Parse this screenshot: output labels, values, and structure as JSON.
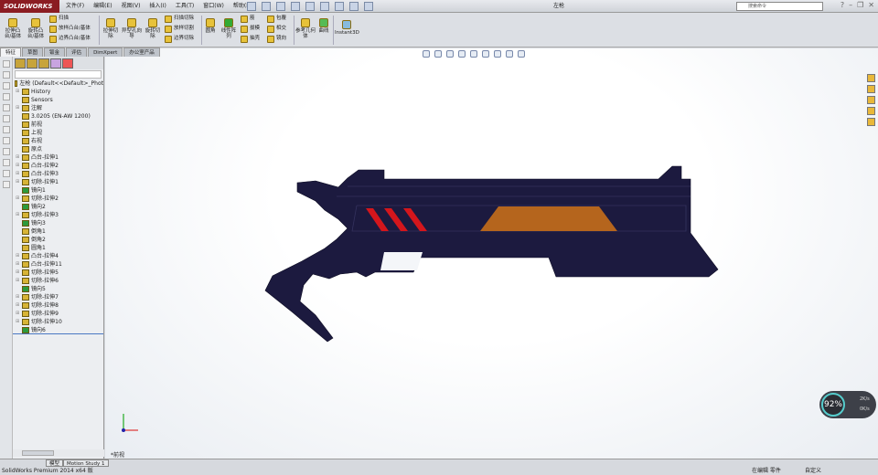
{
  "app": {
    "logo": "SOLIDWORKS",
    "title": "左枪",
    "search_placeholder": "搜索命令"
  },
  "menu": [
    "文件(F)",
    "编辑(E)",
    "视图(V)",
    "插入(I)",
    "工具(T)",
    "窗口(W)",
    "帮助(H)"
  ],
  "ribbon": {
    "large": [
      "拉伸凸台/基体",
      "旋转凸台/基体",
      "拉伸切除",
      "异型孔向导",
      "旋转切除",
      "圆角",
      "线性阵列",
      "参考几何体",
      "曲线",
      "Instant3D"
    ],
    "small": [
      "扫描",
      "放样凸台/基体",
      "边界凸台/基体",
      "扫描切除",
      "放样切割",
      "边界切除",
      "筋",
      "拔模",
      "抽壳",
      "包覆",
      "相交",
      "镜向"
    ]
  },
  "tabs": [
    "特征",
    "草图",
    "钣金",
    "评估",
    "DimXpert",
    "办公室产品"
  ],
  "tree": {
    "root": "左枪 (Default<<Default>_Phot",
    "nodes": [
      {
        "label": "History",
        "exp": true
      },
      {
        "label": "Sensors",
        "exp": false
      },
      {
        "label": "注解",
        "exp": true
      },
      {
        "label": "3.0205 (EN-AW 1200)",
        "exp": false
      },
      {
        "label": "前视",
        "exp": false
      },
      {
        "label": "上视",
        "exp": false
      },
      {
        "label": "右视",
        "exp": false
      },
      {
        "label": "原点",
        "exp": false
      },
      {
        "label": "凸台-拉伸1",
        "exp": true
      },
      {
        "label": "凸台-拉伸2",
        "exp": true
      },
      {
        "label": "凸台-拉伸3",
        "exp": true
      },
      {
        "label": "切除-拉伸1",
        "exp": true
      },
      {
        "label": "镜向1",
        "exp": false,
        "m": true
      },
      {
        "label": "切除-拉伸2",
        "exp": true
      },
      {
        "label": "镜向2",
        "exp": false,
        "m": true
      },
      {
        "label": "切除-拉伸3",
        "exp": true
      },
      {
        "label": "镜向3",
        "exp": false,
        "m": true
      },
      {
        "label": "倒角1",
        "exp": false
      },
      {
        "label": "倒角2",
        "exp": false
      },
      {
        "label": "圆角1",
        "exp": false
      },
      {
        "label": "凸台-拉伸4",
        "exp": true
      },
      {
        "label": "凸台-拉伸11",
        "exp": true
      },
      {
        "label": "切除-拉伸5",
        "exp": true
      },
      {
        "label": "切除-拉伸6",
        "exp": true
      },
      {
        "label": "镜向5",
        "exp": false,
        "m": true
      },
      {
        "label": "切除-拉伸7",
        "exp": true
      },
      {
        "label": "切除-拉伸8",
        "exp": true
      },
      {
        "label": "切除-拉伸9",
        "exp": true
      },
      {
        "label": "切除-拉伸10",
        "exp": true
      },
      {
        "label": "镜向6",
        "exp": false,
        "m": true
      }
    ]
  },
  "viewport": {
    "view_label": "*前视",
    "perf_percent": "92%",
    "perf_up": "2K/s",
    "perf_down": "0K/s"
  },
  "bottom_tabs": [
    "模型",
    "Motion Study 1"
  ],
  "status": {
    "left": "SolidWorks Premium 2014 x64 版",
    "editing": "在编辑 零件",
    "custom": "自定义"
  },
  "colors": {
    "gun": "#1c1a3f",
    "accent_red": "#d4161c",
    "accent_orange": "#b5651d"
  }
}
